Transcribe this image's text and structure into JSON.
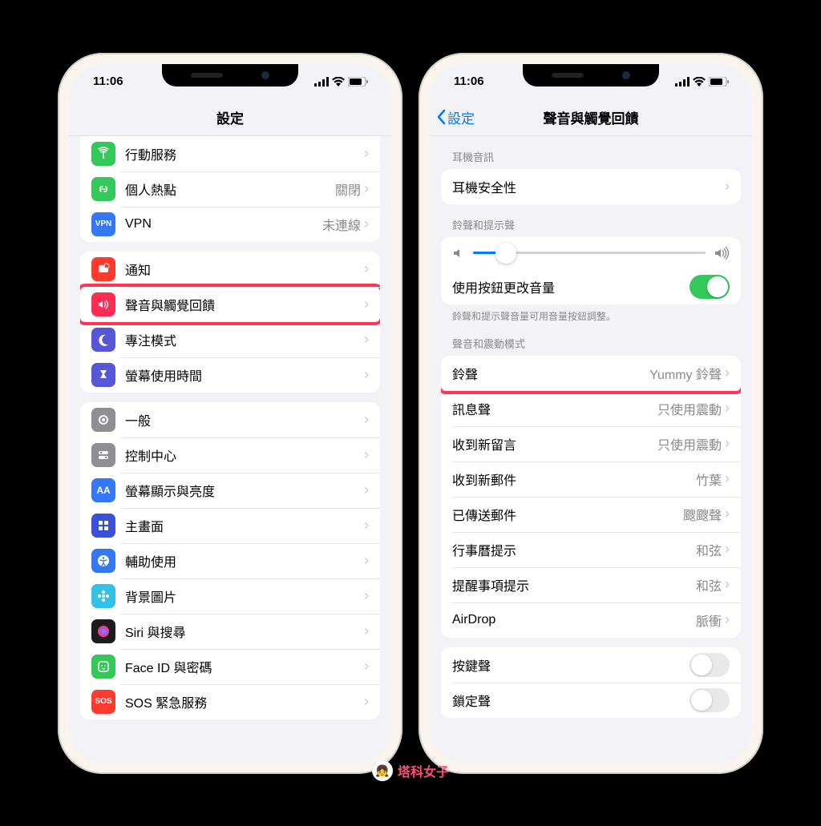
{
  "status": {
    "time": "11:06"
  },
  "left": {
    "title": "設定",
    "group1": [
      {
        "label": "行動服務",
        "value": "",
        "icon": "antenna",
        "color": "#34c759"
      },
      {
        "label": "個人熱點",
        "value": "關閉",
        "icon": "link",
        "color": "#34c759"
      },
      {
        "label": "VPN",
        "value": "未連線",
        "icon": "vpn",
        "color": "#3478f6"
      }
    ],
    "group2": [
      {
        "label": "通知",
        "value": "",
        "icon": "bell",
        "color": "#ff3b30"
      },
      {
        "label": "聲音與觸覺回饋",
        "value": "",
        "icon": "sound",
        "color": "#ff2d55",
        "highlight": true
      },
      {
        "label": "專注模式",
        "value": "",
        "icon": "moon",
        "color": "#5756d6"
      },
      {
        "label": "螢幕使用時間",
        "value": "",
        "icon": "hourglass",
        "color": "#5756d6"
      }
    ],
    "group3": [
      {
        "label": "一般",
        "value": "",
        "icon": "gear",
        "color": "#8e8e93"
      },
      {
        "label": "控制中心",
        "value": "",
        "icon": "switches",
        "color": "#8e8e93"
      },
      {
        "label": "螢幕顯示與亮度",
        "value": "",
        "icon": "aa",
        "color": "#3478f6"
      },
      {
        "label": "主畫面",
        "value": "",
        "icon": "grid",
        "color": "#3b50d8"
      },
      {
        "label": "輔助使用",
        "value": "",
        "icon": "accessibility",
        "color": "#3478f6"
      },
      {
        "label": "背景圖片",
        "value": "",
        "icon": "flower",
        "color": "#34c1e8"
      },
      {
        "label": "Siri 與搜尋",
        "value": "",
        "icon": "siri",
        "color": "#1c1c1e"
      },
      {
        "label": "Face ID 與密碼",
        "value": "",
        "icon": "faceid",
        "color": "#34c759"
      },
      {
        "label": "SOS 緊急服務",
        "value": "",
        "icon": "sos",
        "color": "#ff3b30"
      }
    ]
  },
  "right": {
    "back": "設定",
    "title": "聲音與觸覺回饋",
    "sec1_header": "耳機音訊",
    "headphone_safety": "耳機安全性",
    "sec2_header": "鈴聲和提示聲",
    "use_buttons": "使用按鈕更改音量",
    "use_buttons_on": true,
    "sec2_footer": "鈴聲和提示聲音量可用音量按鈕調整。",
    "sec3_header": "聲音和震動模式",
    "sounds": [
      {
        "label": "鈴聲",
        "value": "Yummy 鈴聲",
        "highlight": true
      },
      {
        "label": "訊息聲",
        "value": "只使用震動"
      },
      {
        "label": "收到新留言",
        "value": "只使用震動"
      },
      {
        "label": "收到新郵件",
        "value": "竹葉"
      },
      {
        "label": "已傳送郵件",
        "value": "颼颼聲"
      },
      {
        "label": "行事曆提示",
        "value": "和弦"
      },
      {
        "label": "提醒事項提示",
        "value": "和弦"
      },
      {
        "label": "AirDrop",
        "value": "脈衝"
      }
    ],
    "toggles": [
      {
        "label": "按鍵聲",
        "on": false
      },
      {
        "label": "鎖定聲",
        "on": false
      }
    ]
  },
  "watermark": "塔科女子"
}
